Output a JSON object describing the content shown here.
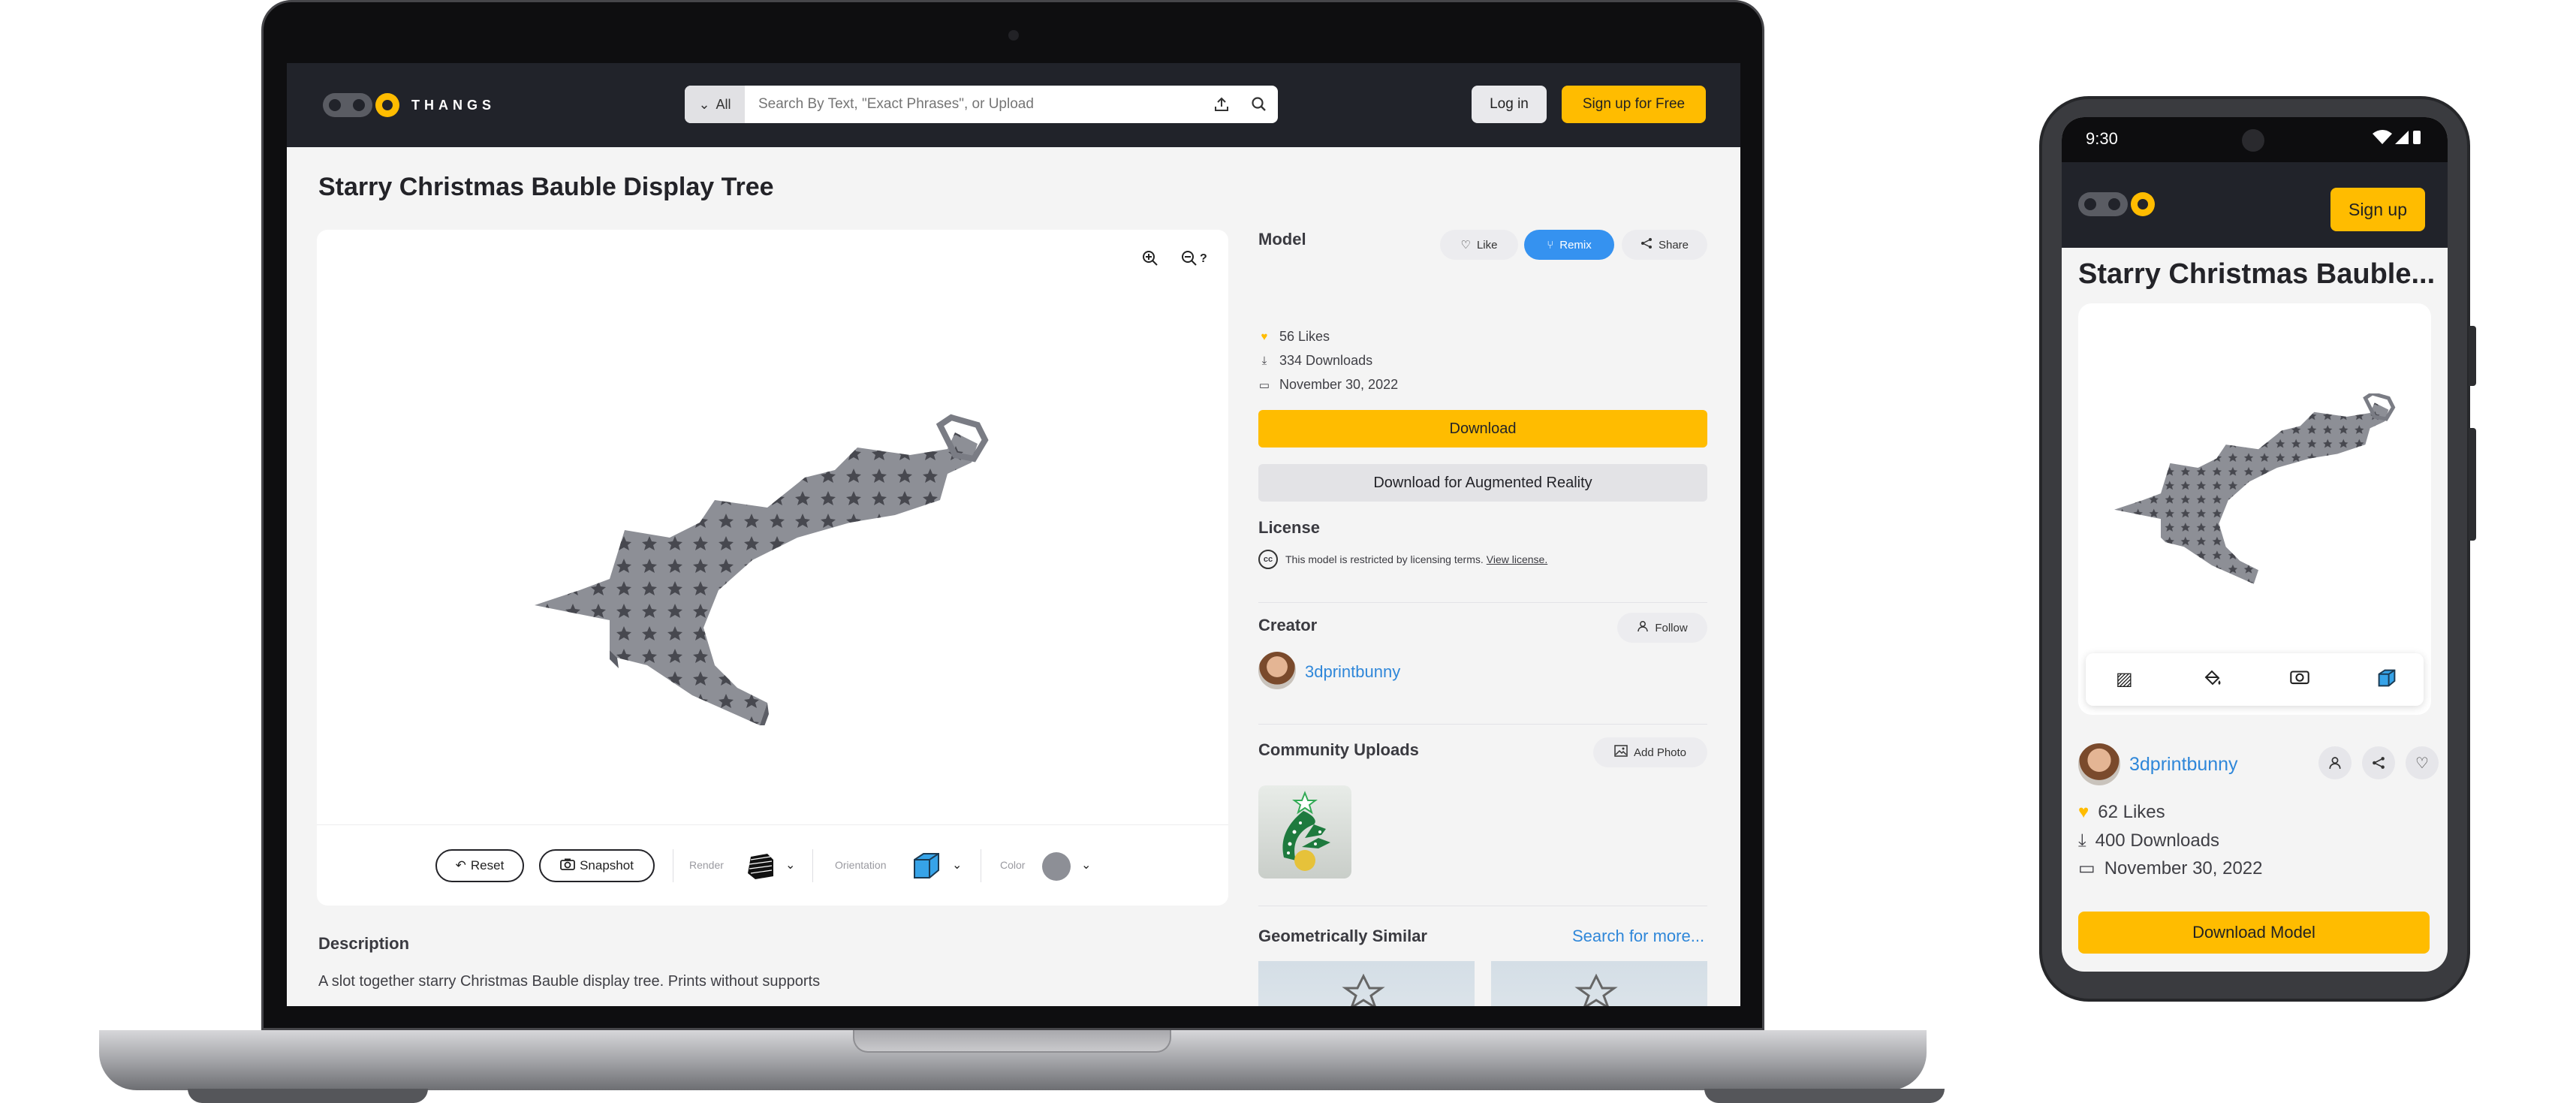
{
  "brand": {
    "name": "THANGS"
  },
  "header": {
    "search_scope": "All",
    "search_placeholder": "Search By Text, \"Exact Phrases\", or Upload",
    "login_label": "Log in",
    "signup_label": "Sign up for Free"
  },
  "model": {
    "title": "Starry Christmas Bauble Display Tree",
    "section_label": "Model",
    "likes": "56 Likes",
    "downloads": "334 Downloads",
    "date": "November 30, 2022",
    "actions": {
      "like": "Like",
      "remix": "Remix",
      "share": "Share"
    },
    "download_label": "Download",
    "download_ar_label": "Download for Augmented Reality"
  },
  "viewer": {
    "zoom_help": "?",
    "reset_label": "Reset",
    "snapshot_label": "Snapshot",
    "render_label": "Render",
    "orientation_label": "Orientation",
    "color_label": "Color"
  },
  "license": {
    "title": "License",
    "icon_text": "cc",
    "text": "This model is restricted by licensing terms.",
    "link": "View license."
  },
  "creator": {
    "title": "Creator",
    "follow_label": "Follow",
    "name": "3dprintbunny"
  },
  "community": {
    "title": "Community Uploads",
    "add_photo_label": "Add Photo"
  },
  "similar": {
    "title": "Geometrically Similar",
    "more_link": "Search for more..."
  },
  "description": {
    "title": "Description",
    "text": "A slot together starry Christmas Bauble display tree. Prints without supports"
  },
  "phone": {
    "time": "9:30",
    "signup_label": "Sign up",
    "title": "Starry Christmas Bauble...",
    "creator": "3dprintbunny",
    "likes": "62 Likes",
    "downloads": "400 Downloads",
    "date": "November 30, 2022",
    "download_label": "Download Model"
  },
  "colors": {
    "brand_yellow": "#ffbc00",
    "header_dark": "#21232a",
    "remix_blue": "#3592f0",
    "link_blue": "#2f87d9",
    "model_gray": "#8d8f96"
  }
}
